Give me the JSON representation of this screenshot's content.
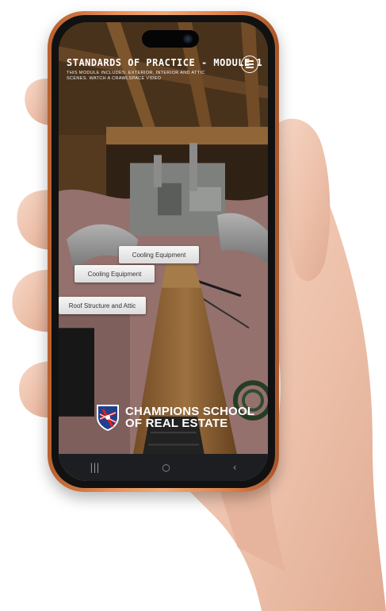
{
  "module": {
    "title": "STANDARDS OF PRACTICE - MODULE 1",
    "subtitle": "THIS MODULE INCLUDES: EXTERIOR, INTERIOR AND ATTIC SCENES.  WATCH A CRAWLSPACE VIDEO"
  },
  "menu": {
    "icon": "hamburger-menu-icon"
  },
  "hotspots": [
    {
      "label": "Cooling Equipment"
    },
    {
      "label": "Cooling Equipment"
    },
    {
      "label": "Roof Structure and Attic"
    }
  ],
  "brand": {
    "line1": "CHAMPIONS SCHOOL",
    "line2": "OF REAL ESTATE",
    "logo_icon": "shield-flag-icon"
  },
  "navbar": {
    "recent": "|||",
    "home": "○",
    "back": "‹"
  }
}
